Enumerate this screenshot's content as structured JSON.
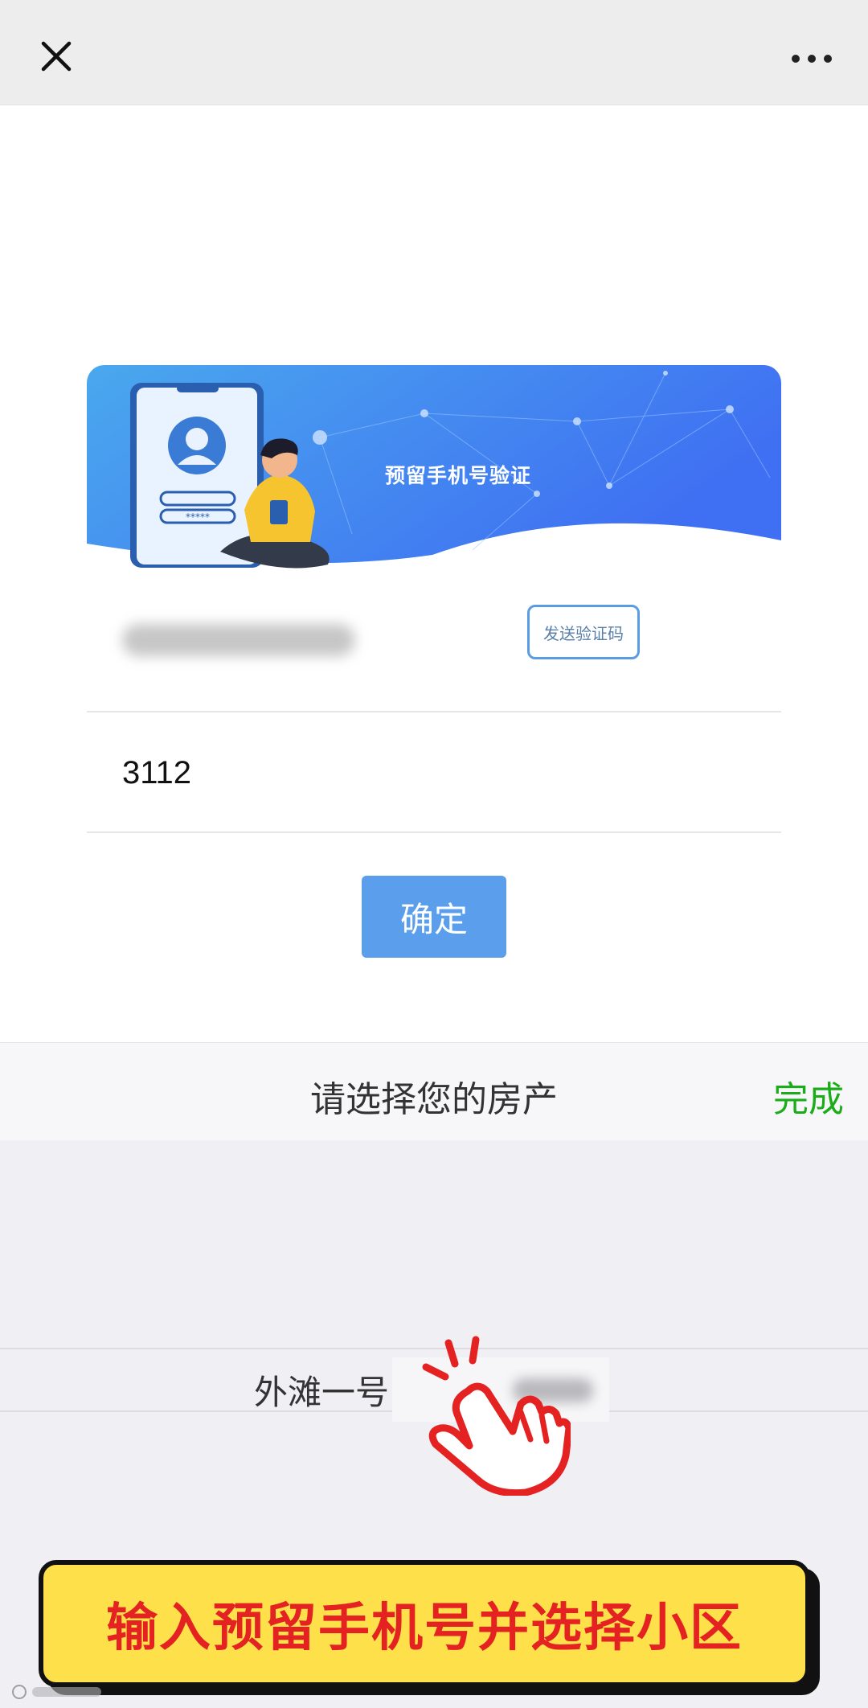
{
  "topbar": {
    "close_icon": "close-icon",
    "more_icon": "more-dots-icon"
  },
  "banner": {
    "title": "预留手机号验证"
  },
  "form": {
    "send_code_label": "发送验证码",
    "code_value": "3112",
    "confirm_label": "确定"
  },
  "picker": {
    "title": "请选择您的房产",
    "done_label": "完成",
    "option_label": "外滩一号"
  },
  "caption": {
    "text": "输入预留手机号并选择小区"
  },
  "colors": {
    "accent_blue": "#5a9eec",
    "done_green": "#1aad19",
    "caption_red": "#e52222",
    "caption_yellow": "#fde04a"
  }
}
